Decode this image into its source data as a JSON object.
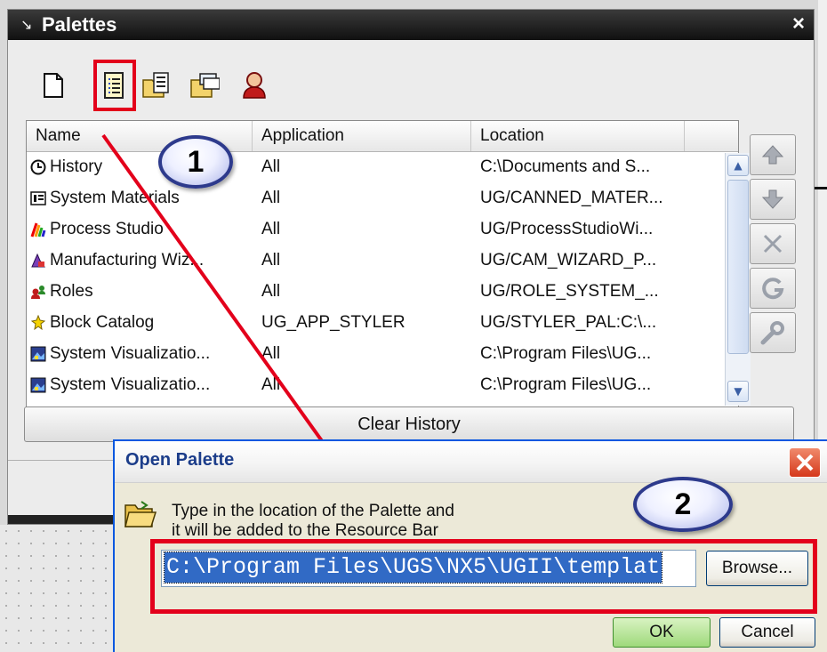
{
  "palettes_window": {
    "title": "Palettes",
    "close_label": "×",
    "toolbar_icons": [
      "new-palette-icon",
      "open-palette-icon",
      "open-folder-palette-icon",
      "share-palette-icon",
      "roles-icon"
    ],
    "columns": [
      "Name",
      "Application",
      "Location"
    ],
    "rows": [
      {
        "icon": "history-icon",
        "name": "History",
        "application": "All",
        "location": "C:\\Documents and S..."
      },
      {
        "icon": "materials-icon",
        "name": "System Materials",
        "application": "All",
        "location": "UG/CANNED_MATER..."
      },
      {
        "icon": "process-studio-icon",
        "name": "Process Studio",
        "application": "All",
        "location": "UG/ProcessStudioWi..."
      },
      {
        "icon": "manufacturing-icon",
        "name": "Manufacturing Wiz...",
        "application": "All",
        "location": "UG/CAM_WIZARD_P..."
      },
      {
        "icon": "roles-icon",
        "name": "Roles",
        "application": "All",
        "location": "UG/ROLE_SYSTEM_..."
      },
      {
        "icon": "block-catalog-icon",
        "name": "Block Catalog",
        "application": "UG_APP_STYLER",
        "location": "UG/STYLER_PAL:C:\\..."
      },
      {
        "icon": "visualization-icon",
        "name": "System Visualizatio...",
        "application": "All",
        "location": "C:\\Program Files\\UG..."
      },
      {
        "icon": "visualization-icon",
        "name": "System Visualizatio...",
        "application": "All",
        "location": "C:\\Program Files\\UG..."
      }
    ],
    "side_buttons": [
      "move-up-icon",
      "move-down-icon",
      "remove-icon",
      "refresh-icon",
      "properties-wrench-icon"
    ],
    "clear_history_label": "Clear History"
  },
  "callouts": {
    "one": "1",
    "two": "2"
  },
  "open_palette_dialog": {
    "title": "Open Palette",
    "instruction_line1": "Type in the location of the Palette and",
    "instruction_line2": "it will be added to the Resource Bar",
    "path_value": "C:\\Program Files\\UGS\\NX5\\UGII\\templat",
    "browse_label": "Browse...",
    "ok_label": "OK",
    "cancel_label": "Cancel"
  },
  "colors": {
    "highlight_red": "#e3001b",
    "title_bar": "#1a1a1a",
    "selection_blue": "#316ac5",
    "callout_border": "#2d3a8c"
  }
}
